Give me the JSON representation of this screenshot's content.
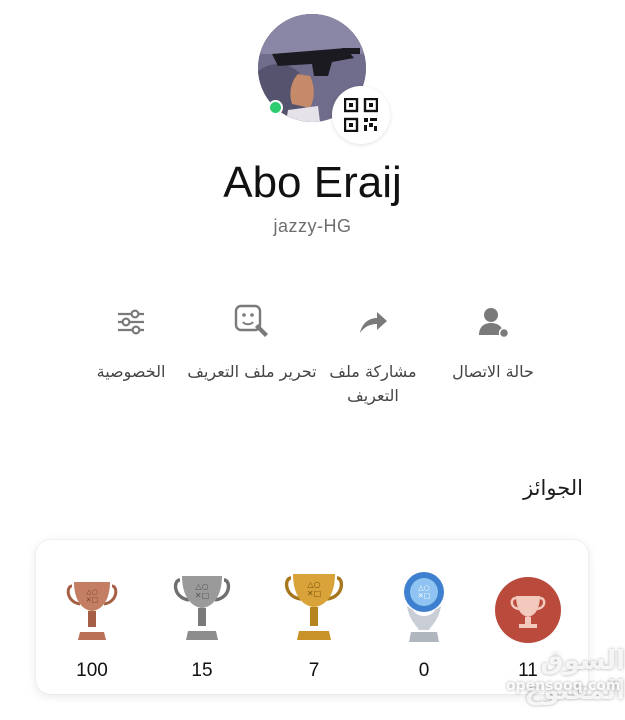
{
  "profile": {
    "name": "Abo Eraij",
    "handle": "jazzy-HG",
    "online": true
  },
  "actions": [
    {
      "id": "online-status",
      "icon": "person-status-icon",
      "label": "حالة الاتصال"
    },
    {
      "id": "share-profile",
      "icon": "share-arrow-icon",
      "label": "مشاركة ملف التعريف"
    },
    {
      "id": "edit-profile",
      "icon": "edit-face-icon",
      "label": "تحرير ملف التعريف"
    },
    {
      "id": "privacy",
      "icon": "sliders-icon",
      "label": "الخصوصية"
    }
  ],
  "trophies": {
    "title": "الجوائز",
    "level": "11",
    "items": [
      {
        "type": "bronze",
        "count": "100"
      },
      {
        "type": "silver",
        "count": "15"
      },
      {
        "type": "gold",
        "count": "7"
      },
      {
        "type": "platinum",
        "count": "0"
      }
    ]
  },
  "watermark": {
    "text": "السوق المفتوح",
    "sub": "opensooq.com"
  },
  "colors": {
    "online": "#2ecc71",
    "bronze": "#b86f55",
    "silver": "#8c8c8c",
    "gold": "#c99228",
    "platinum": "#4a8fd6",
    "level_badge": "#b94a3c"
  }
}
